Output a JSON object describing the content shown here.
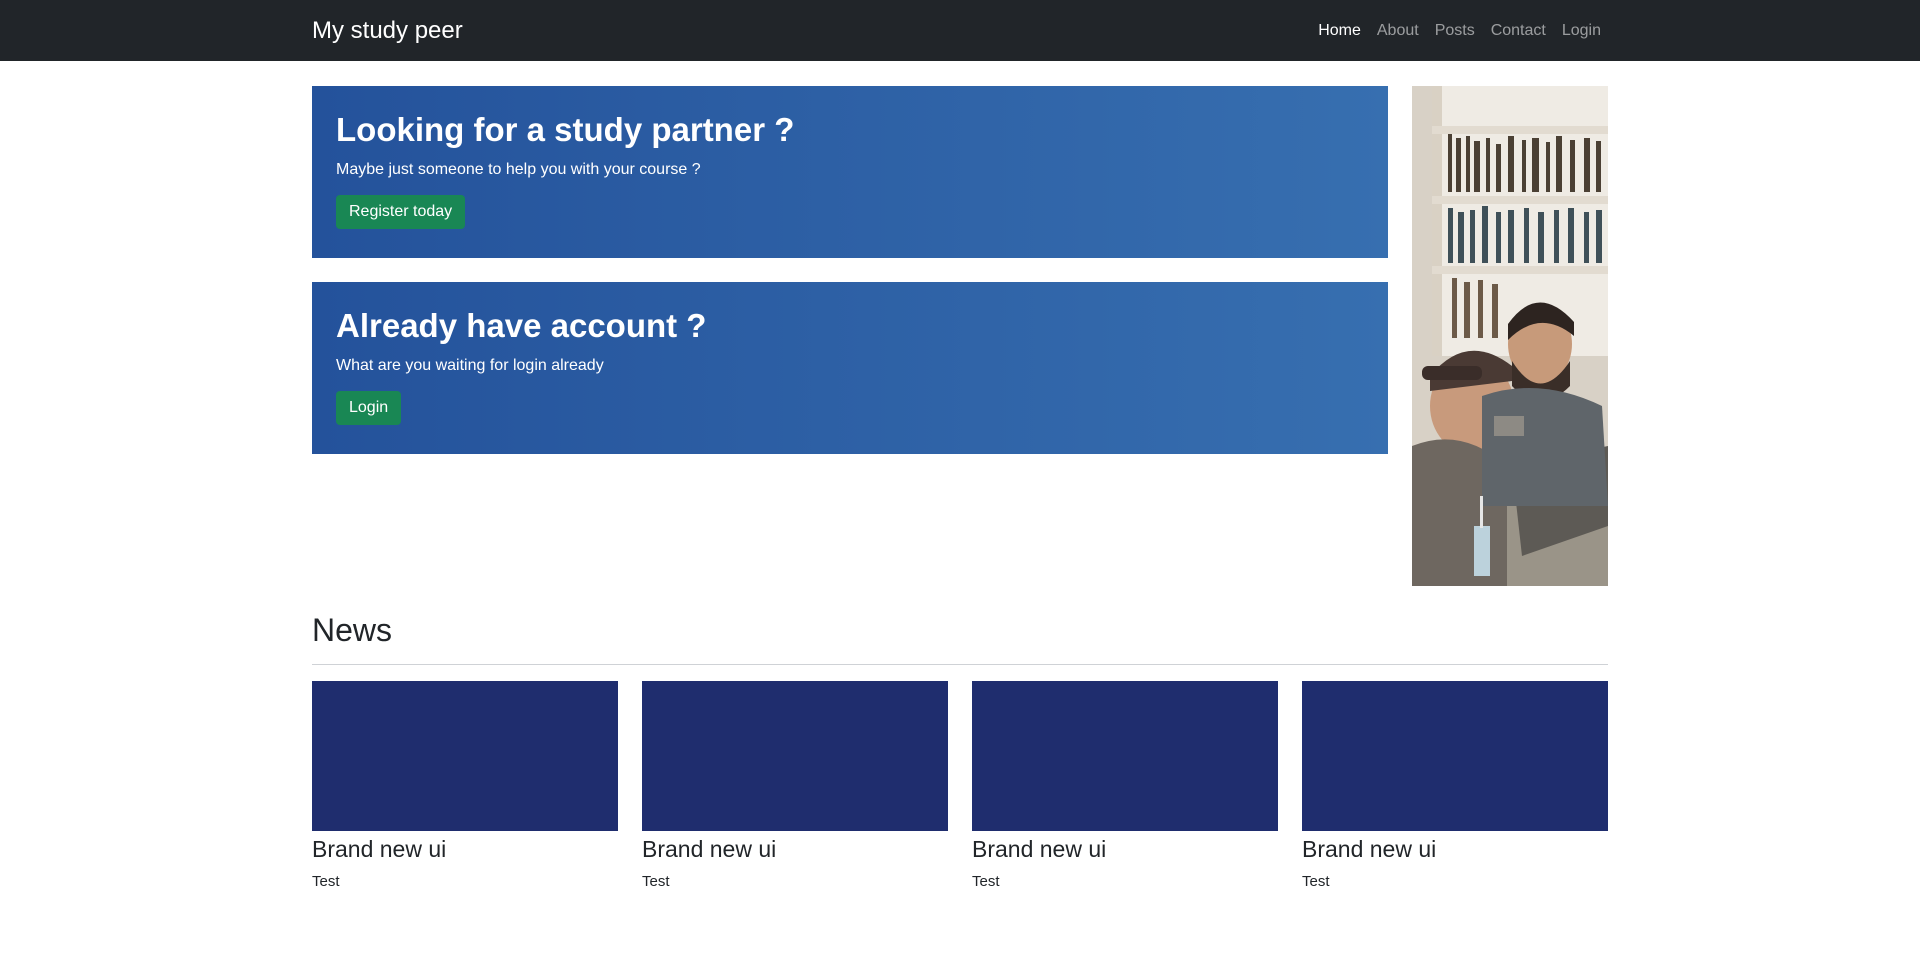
{
  "navbar": {
    "brand": "My study peer",
    "links": [
      "Home",
      "About",
      "Posts",
      "Contact",
      "Login"
    ],
    "active": "Home"
  },
  "hero": [
    {
      "title": "Looking for a study partner ?",
      "subtitle": "Maybe just someone to help you with your course ?",
      "button": "Register today"
    },
    {
      "title": "Already have account ?",
      "subtitle": "What are you waiting for login already",
      "button": "Login"
    }
  ],
  "news": {
    "title": "News",
    "cards": [
      {
        "title": "Brand new ui",
        "text": "Test"
      },
      {
        "title": "Brand new ui",
        "text": "Test"
      },
      {
        "title": "Brand new ui",
        "text": "Test"
      },
      {
        "title": "Brand new ui",
        "text": "Test"
      }
    ]
  },
  "colors": {
    "navbar": "#212529",
    "hero_start": "#24529b",
    "hero_end": "#376fb0",
    "button": "#198754",
    "card_thumb": "#1f2d6e"
  },
  "image": {
    "side_photo": "students-library-photo"
  }
}
